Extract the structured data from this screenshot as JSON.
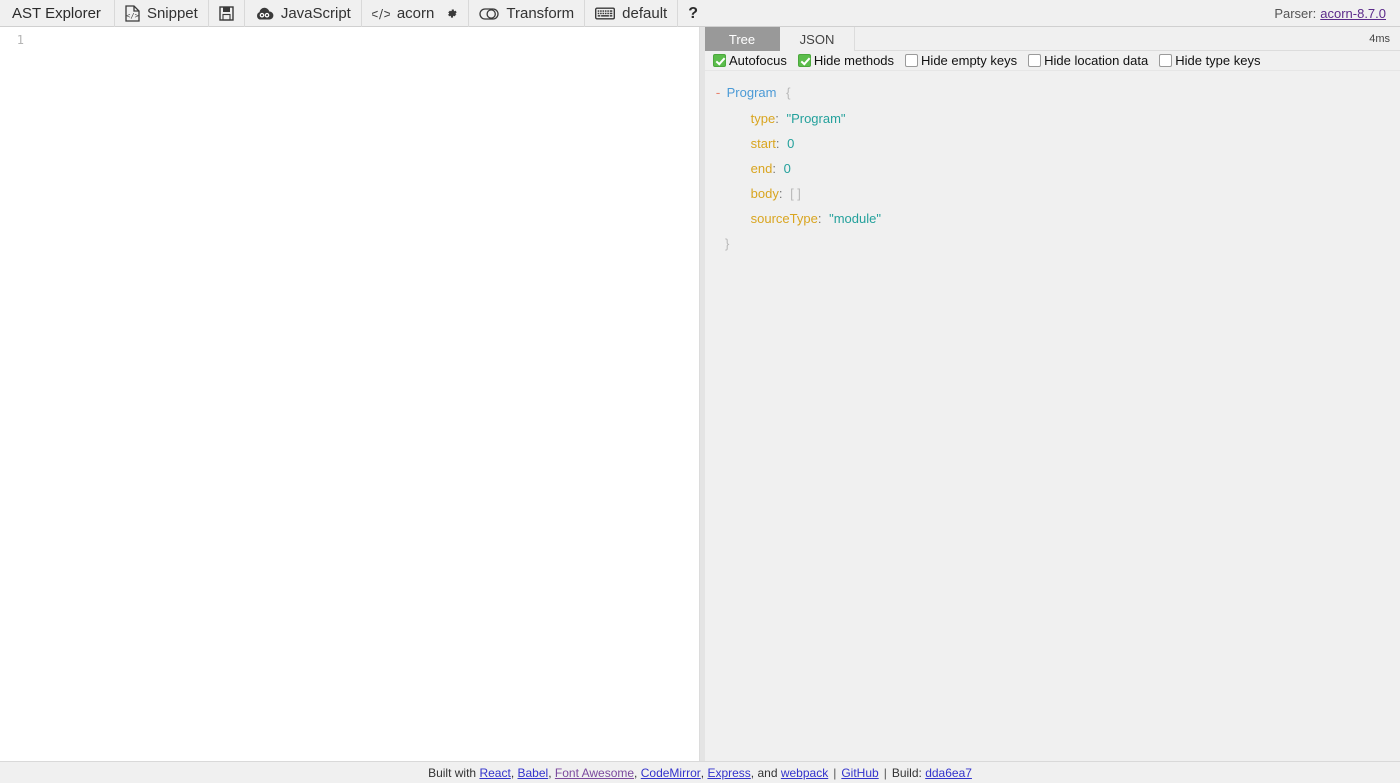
{
  "app": {
    "title": "AST Explorer"
  },
  "toolbar": {
    "snippet_label": "Snippet",
    "snippet_icon": "file-code-icon",
    "save_icon": "floppy-save-icon",
    "language_label": "JavaScript",
    "language_icon": "javascript-cloud-icon",
    "parser_label": "acorn",
    "parser_icon": "code-brackets-icon",
    "settings_icon": "gear-icon",
    "transform_label": "Transform",
    "transform_icon": "toggle-switch-icon",
    "keymap_label": "default",
    "keymap_icon": "keyboard-icon",
    "help_label": "?",
    "parser_prefix": "Parser:",
    "parser_version": "acorn-8.7.0"
  },
  "editor": {
    "lines": [
      "1"
    ],
    "content": ""
  },
  "result": {
    "tabs": [
      {
        "label": "Tree",
        "active": true
      },
      {
        "label": "JSON",
        "active": false
      }
    ],
    "timing": "4ms",
    "settings": [
      {
        "label": "Autofocus",
        "checked": true
      },
      {
        "label": "Hide methods",
        "checked": true
      },
      {
        "label": "Hide empty keys",
        "checked": false
      },
      {
        "label": "Hide location data",
        "checked": false
      },
      {
        "label": "Hide type keys",
        "checked": false
      }
    ],
    "tree": {
      "toggle": "-",
      "root_name": "Program",
      "open_brace": "{",
      "close_brace": "}",
      "properties": [
        {
          "key": "type",
          "value": "\"Program\"",
          "kind": "string"
        },
        {
          "key": "start",
          "value": "0",
          "kind": "number"
        },
        {
          "key": "end",
          "value": "0",
          "kind": "number"
        },
        {
          "key": "body",
          "value": "[ ]",
          "kind": "empty"
        },
        {
          "key": "sourceType",
          "value": "\"module\"",
          "kind": "string"
        }
      ]
    }
  },
  "footer": {
    "built_with": "Built with",
    "links": [
      {
        "label": "React",
        "visited": false
      },
      {
        "label": "Babel",
        "visited": false
      },
      {
        "label": "Font Awesome",
        "visited": true
      },
      {
        "label": "CodeMirror",
        "visited": false
      },
      {
        "label": "Express",
        "visited": false
      }
    ],
    "and_text": ", and",
    "webpack_label": "webpack",
    "github_label": "GitHub",
    "build_prefix": "Build:",
    "build_hash": "dda6ea7",
    "separator": "|"
  },
  "colors": {
    "toolbar_bg": "#f0f0f0",
    "panel_bg": "#f0f0f0",
    "tab_active_bg": "#999999",
    "checkbox_checked": "#5bbd4b",
    "node_name": "#4b9ad6",
    "prop_key": "#d9a520",
    "value": "#24a19c",
    "link": "#3333cc",
    "visited_link": "#7b4a9e"
  }
}
